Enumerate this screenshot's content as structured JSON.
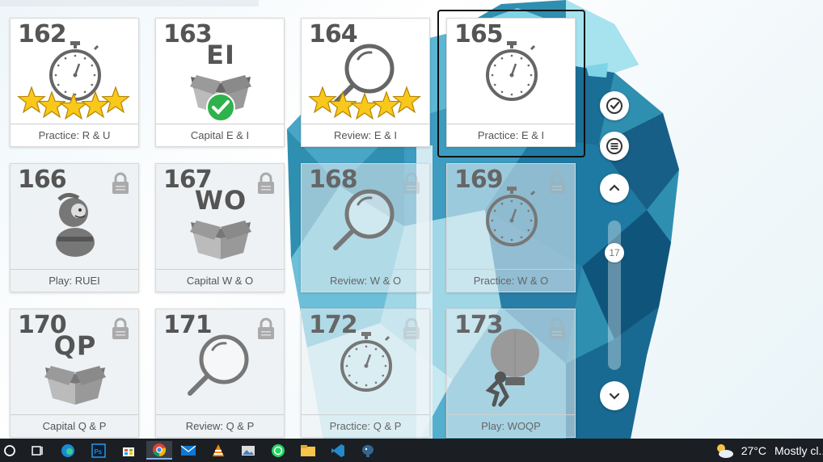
{
  "cards": [
    {
      "number": "162",
      "label": "Practice: R & U",
      "icon": "stopwatch-icon",
      "stars": 5,
      "locked": false
    },
    {
      "number": "163",
      "label": "Capital E & I",
      "icon": "box-icon",
      "box_text": "EI",
      "completed": true,
      "locked": false
    },
    {
      "number": "164",
      "label": "Review: E & I",
      "icon": "magnifier-icon",
      "stars": 5,
      "locked": false
    },
    {
      "number": "165",
      "label": "Practice: E & I",
      "icon": "stopwatch-icon",
      "locked": false,
      "selected": true
    },
    {
      "number": "166",
      "label": "Play: RUEI",
      "icon": "character-icon",
      "locked": true
    },
    {
      "number": "167",
      "label": "Capital W & O",
      "icon": "box-icon",
      "box_text": "WO",
      "locked": true
    },
    {
      "number": "168",
      "label": "Review: W & O",
      "icon": "magnifier-icon",
      "locked": true
    },
    {
      "number": "169",
      "label": "Practice: W & O",
      "icon": "stopwatch-icon",
      "locked": true
    },
    {
      "number": "170",
      "label": "Capital Q & P",
      "icon": "box-icon",
      "box_text": "QP",
      "locked": true
    },
    {
      "number": "171",
      "label": "Review: Q & P",
      "icon": "magnifier-icon",
      "locked": true
    },
    {
      "number": "172",
      "label": "Practice: Q & P",
      "icon": "stopwatch-icon",
      "locked": true
    },
    {
      "number": "173",
      "label": "Play: WOQP",
      "icon": "balloon-icon",
      "locked": true
    }
  ],
  "controls": {
    "scroll_position_label": "17",
    "icons": [
      "check-circle-icon",
      "menu-icon",
      "chevron-up-icon",
      "chevron-down-icon"
    ]
  },
  "taskbar": {
    "apps": [
      "start-icon",
      "task-view-icon",
      "edge-icon",
      "photoshop-icon",
      "store-icon",
      "chrome-icon",
      "mail-icon",
      "vlc-icon",
      "photos-icon",
      "whatsapp-icon",
      "file-explorer-icon",
      "vscode-icon",
      "postgres-icon"
    ],
    "weather_temp": "27°C",
    "weather_text": "Mostly cl..."
  }
}
